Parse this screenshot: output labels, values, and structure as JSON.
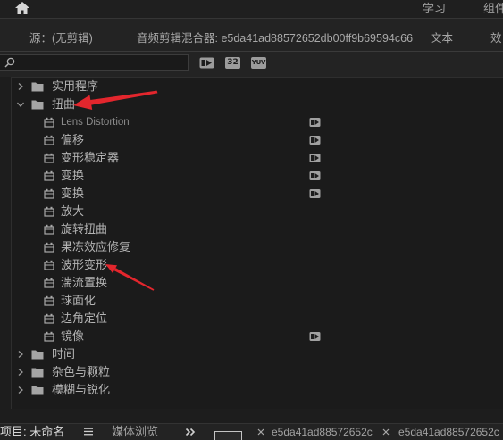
{
  "colors": {
    "background": "#1d1d1d",
    "panel": "#232323",
    "text": "#b4b4b4",
    "text_muted": "#8b8b8b",
    "annotation_red": "#e3262d"
  },
  "top_bar": {
    "home_icon": "home-icon",
    "workspaces": [
      {
        "label": "学习"
      },
      {
        "label": "组件"
      }
    ]
  },
  "panel_tabs": [
    {
      "label": "源：(无剪辑)"
    },
    {
      "label": "音频剪辑混合器: e5da41ad88572652db00ff9b69594c66"
    },
    {
      "label": "文本"
    },
    {
      "label": "效"
    }
  ],
  "effects_toolbar": {
    "search": {
      "icon": "search-icon",
      "value": ""
    },
    "filters": [
      {
        "icon": "accelerated-effects-icon"
      },
      {
        "icon": "32-bit-color-icon",
        "label": "32"
      },
      {
        "icon": "yuv-icon",
        "label": "YUV"
      }
    ]
  },
  "effects_tree": [
    {
      "folder": true,
      "label": "实用程序",
      "expanded": false
    },
    {
      "folder": true,
      "label": "扭曲",
      "expanded": true
    },
    {
      "folder": false,
      "label": "Lens Distortion",
      "accelerated": true,
      "muted": true
    },
    {
      "folder": false,
      "label": "偏移",
      "accelerated": true
    },
    {
      "folder": false,
      "label": "变形稳定器",
      "accelerated": true
    },
    {
      "folder": false,
      "label": "变换",
      "accelerated": true
    },
    {
      "folder": false,
      "label": "变换",
      "accelerated": true
    },
    {
      "folder": false,
      "label": "放大",
      "accelerated": false
    },
    {
      "folder": false,
      "label": "旋转扭曲",
      "accelerated": false
    },
    {
      "folder": false,
      "label": "果冻效应修复",
      "accelerated": false
    },
    {
      "folder": false,
      "label": "波形变形",
      "accelerated": false
    },
    {
      "folder": false,
      "label": "湍流置换",
      "accelerated": false
    },
    {
      "folder": false,
      "label": "球面化",
      "accelerated": false
    },
    {
      "folder": false,
      "label": "边角定位",
      "accelerated": false
    },
    {
      "folder": false,
      "label": "镜像",
      "accelerated": true
    },
    {
      "folder": true,
      "label": "时间",
      "expanded": false
    },
    {
      "folder": true,
      "label": "杂色与颗粒",
      "expanded": false
    },
    {
      "folder": true,
      "label": "模糊与锐化",
      "expanded": false
    }
  ],
  "bottom_tabs": {
    "project": {
      "label": "项目: 未命名",
      "menu_icon": "hamburger-menu-icon"
    },
    "media_browser": {
      "label": "媒体浏览"
    },
    "overflow_icon": "double-chevron-right-icon",
    "sequences": [
      {
        "label": "e5da41ad88572652c",
        "close_icon": "close-icon"
      },
      {
        "label": "e5da41ad88572652c",
        "close_icon": "close-icon"
      }
    ]
  }
}
